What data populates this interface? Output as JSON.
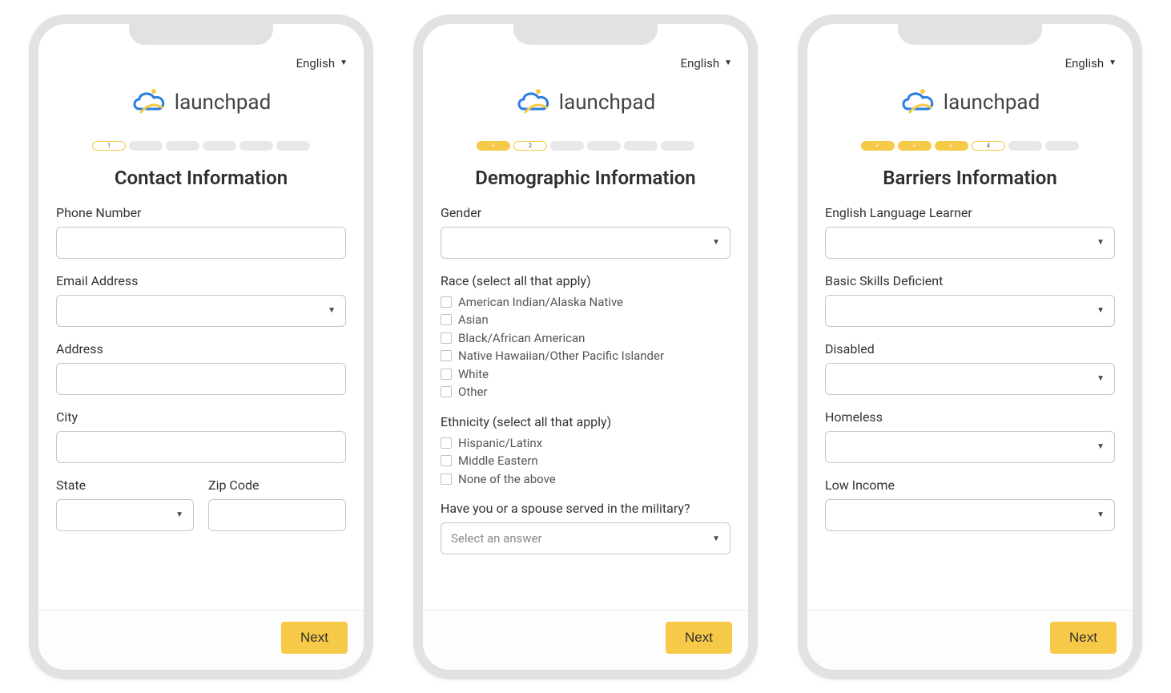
{
  "language_label": "English",
  "brand": "launchpad",
  "next_label": "Next",
  "screens": [
    {
      "title": "Contact Information",
      "progress": {
        "total": 6,
        "done": 0,
        "current": 1
      },
      "fields": [
        {
          "kind": "text",
          "label": "Phone Number",
          "name": "phone-number-field"
        },
        {
          "kind": "select",
          "label": "Email Address",
          "name": "email-address-select"
        },
        {
          "kind": "text",
          "label": "Address",
          "name": "address-field"
        },
        {
          "kind": "text",
          "label": "City",
          "name": "city-field"
        }
      ],
      "row2": [
        {
          "kind": "select",
          "label": "State",
          "name": "state-select"
        },
        {
          "kind": "text",
          "label": "Zip Code",
          "name": "zip-code-field"
        }
      ]
    },
    {
      "title": "Demographic Information",
      "progress": {
        "total": 6,
        "done": 1,
        "current": 2
      },
      "gender_label": "Gender",
      "race_label": "Race (select all that apply)",
      "race_options": [
        "American Indian/Alaska Native",
        "Asian",
        "Black/African American",
        "Native Hawaiian/Other Pacific Islander",
        "White",
        "Other"
      ],
      "ethnicity_label": "Ethnicity (select all that apply)",
      "ethnicity_options": [
        "Hispanic/Latinx",
        "Middle Eastern",
        "None of the above"
      ],
      "military_label": "Have you or a spouse served in the military?",
      "military_placeholder": "Select an answer"
    },
    {
      "title": "Barriers Information",
      "progress": {
        "total": 6,
        "done": 3,
        "current": 4
      },
      "selects": [
        {
          "label": "English Language Learner",
          "name": "ell-select"
        },
        {
          "label": "Basic Skills Deficient",
          "name": "basic-skills-select"
        },
        {
          "label": "Disabled",
          "name": "disabled-select"
        },
        {
          "label": "Homeless",
          "name": "homeless-select"
        },
        {
          "label": "Low Income",
          "name": "low-income-select"
        }
      ]
    }
  ]
}
